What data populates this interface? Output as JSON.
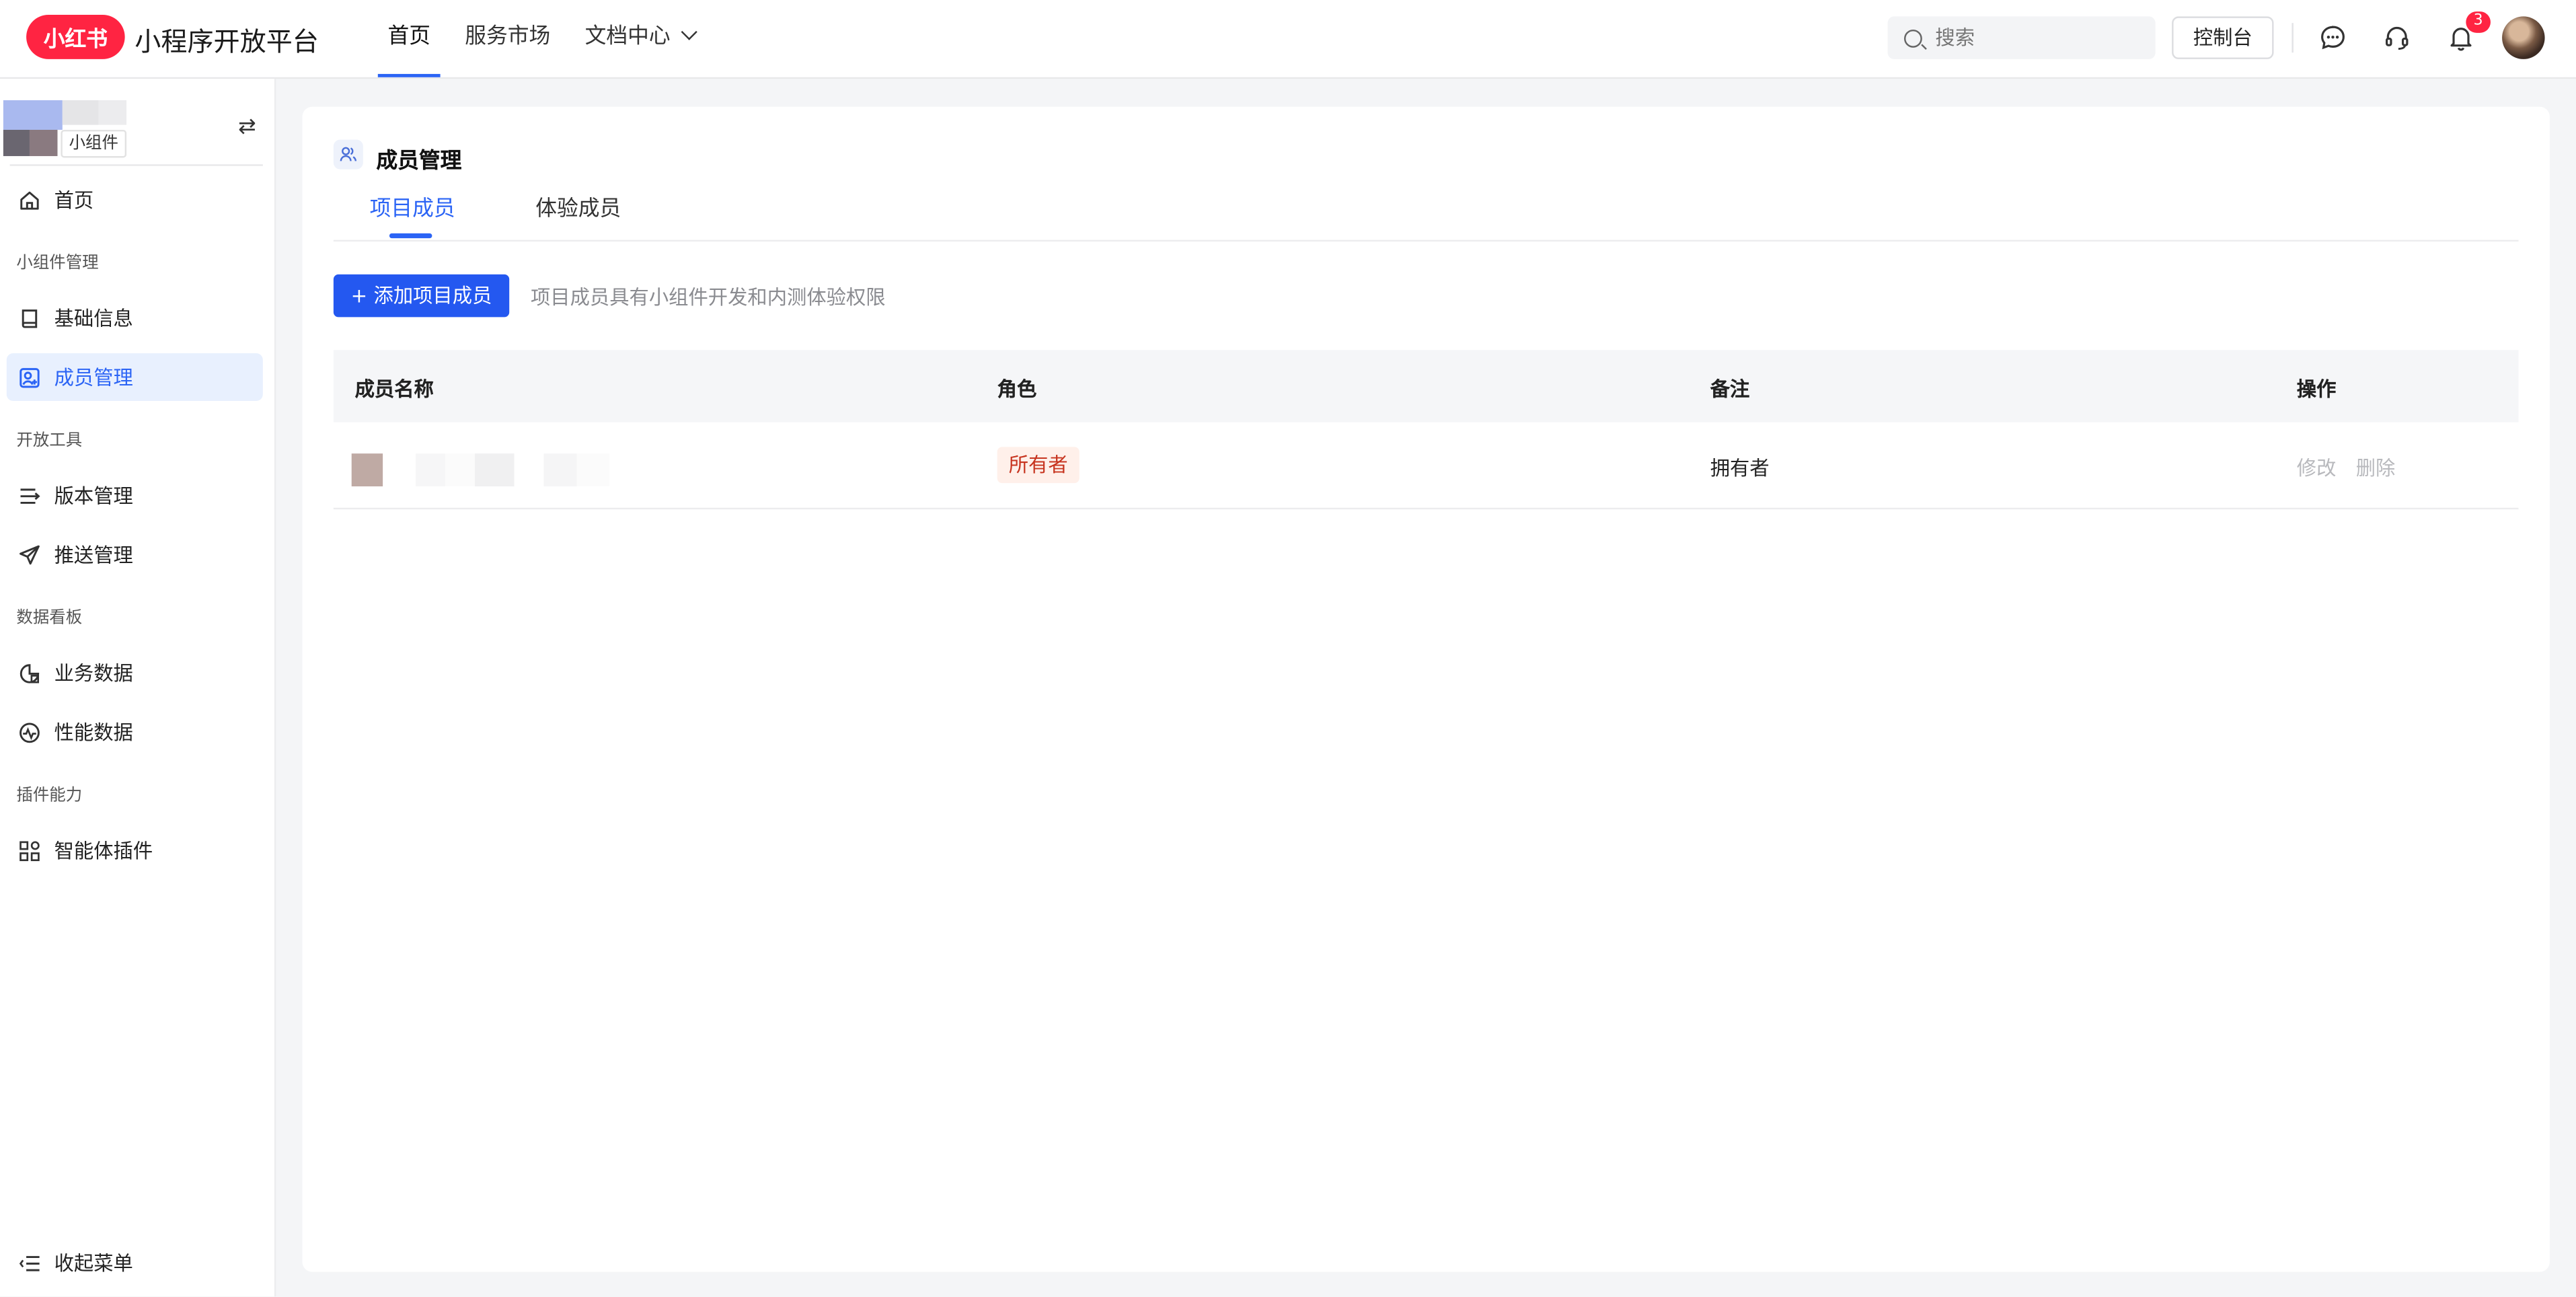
{
  "header": {
    "logo_text": "小红书",
    "brand": "小程序开放平台",
    "nav": [
      {
        "label": "首页",
        "active": true
      },
      {
        "label": "服务市场",
        "active": false
      },
      {
        "label": "文档中心",
        "active": false
      }
    ],
    "search_placeholder": "搜索",
    "console_label": "控制台",
    "notification_count": "3",
    "icons": [
      "message-icon",
      "headset-icon",
      "bell-icon"
    ]
  },
  "sidebar": {
    "app_tag": "小组件",
    "home": "首页",
    "groups": [
      {
        "title": "小组件管理",
        "items": [
          "基础信息",
          "成员管理"
        ]
      },
      {
        "title": "开放工具",
        "items": [
          "版本管理",
          "推送管理"
        ]
      },
      {
        "title": "数据看板",
        "items": [
          "业务数据",
          "性能数据"
        ]
      },
      {
        "title": "插件能力",
        "items": [
          "智能体插件"
        ]
      }
    ],
    "active_item": "成员管理",
    "collapse_label": "收起菜单"
  },
  "main": {
    "title": "成员管理",
    "tabs": [
      {
        "label": "项目成员",
        "active": true
      },
      {
        "label": "体验成员",
        "active": false
      }
    ],
    "add_button": "+ 添加项目成员",
    "hint": "项目成员具有小组件开发和内测体验权限",
    "table": {
      "columns": [
        "成员名称",
        "角色",
        "备注",
        "操作"
      ],
      "rows": [
        {
          "role": "所有者",
          "note": "拥有者",
          "actions": [
            "修改",
            "删除"
          ]
        }
      ]
    }
  },
  "colors": {
    "brand_red": "#ff2442",
    "accent_blue": "#2b64f5",
    "owner_tag_bg": "#fff0ea",
    "owner_tag_text": "#c7341f"
  }
}
